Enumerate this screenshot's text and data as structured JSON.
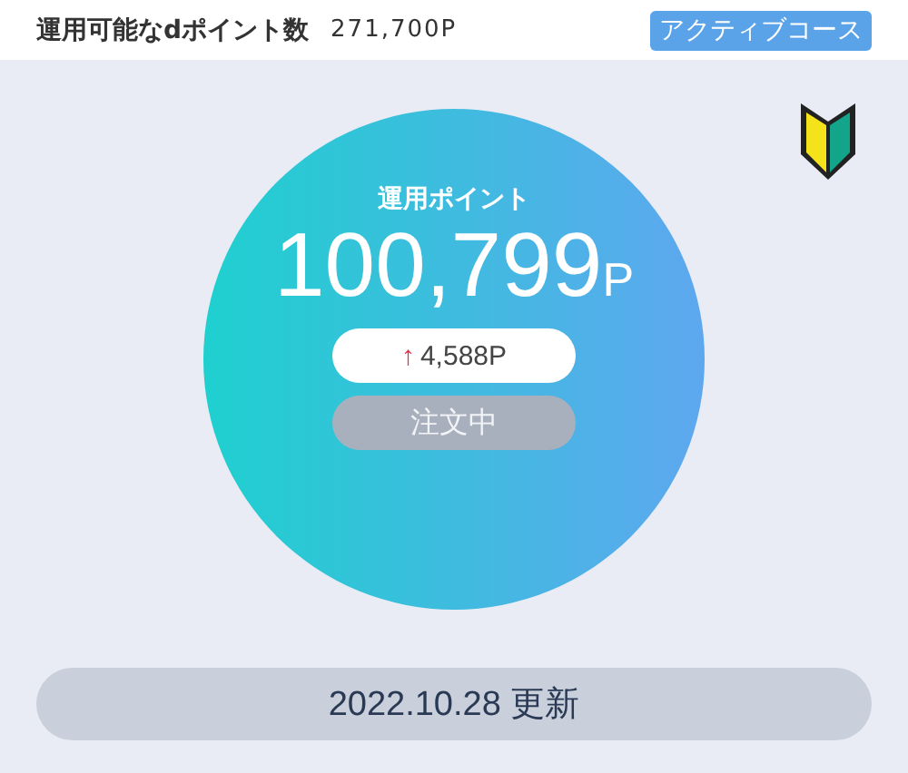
{
  "header": {
    "label": "運用可能なdポイント数",
    "value": "271,700P",
    "badge": "アクティブコース"
  },
  "summary": {
    "label": "運用ポイント",
    "value": "100,799",
    "unit": "P",
    "change": {
      "kind": "rise",
      "arrow": "↑",
      "value": "4,588P"
    },
    "status": "注文中"
  },
  "updated": "2022.10.28 更新"
}
